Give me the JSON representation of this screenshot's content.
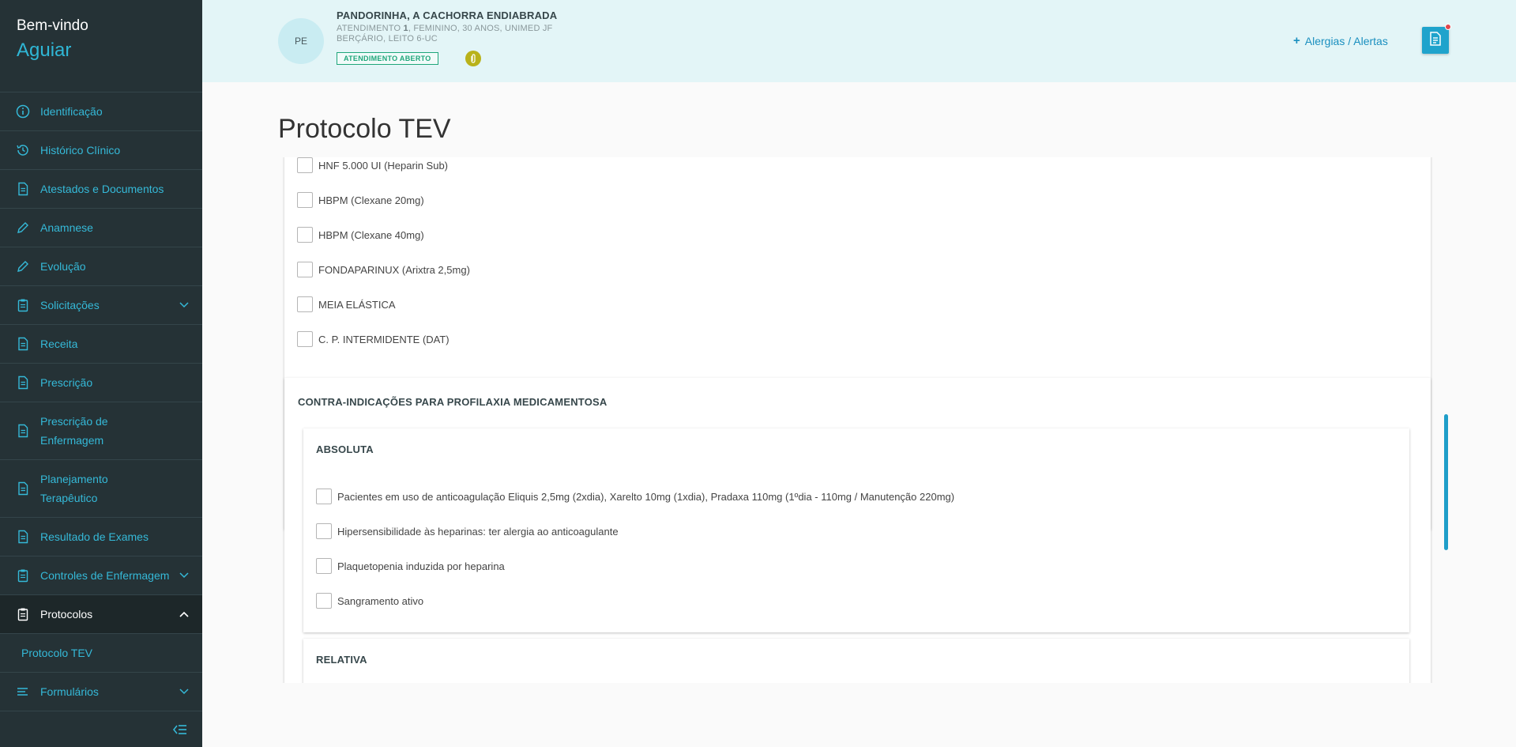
{
  "sidebar": {
    "welcome": "Bem-vindo",
    "user": "Aguiar",
    "items": [
      {
        "label": "Identificação",
        "icon": "info-icon"
      },
      {
        "label": "Histórico Clínico",
        "icon": "history-icon"
      },
      {
        "label": "Atestados e Documentos",
        "icon": "document-icon"
      },
      {
        "label": "Anamnese",
        "icon": "pencil-icon"
      },
      {
        "label": "Evolução",
        "icon": "pencil-icon"
      },
      {
        "label": "Solicitações",
        "icon": "clipboard-icon"
      },
      {
        "label": "Receita",
        "icon": "document-icon"
      },
      {
        "label": "Prescrição",
        "icon": "document-icon"
      },
      {
        "label": "Prescrição de Enfermagem",
        "icon": "document-icon"
      },
      {
        "label": "Planejamento Terapêutico",
        "icon": "document-icon"
      },
      {
        "label": "Resultado de Exames",
        "icon": "document-icon"
      },
      {
        "label": "Controles de Enfermagem",
        "icon": "clipboard-icon"
      },
      {
        "label": "Protocolos",
        "icon": "clipboard-icon"
      },
      {
        "label": "Formulários",
        "icon": "list-icon"
      }
    ],
    "sub_item": "Protocolo TEV"
  },
  "patient": {
    "initials": "PE",
    "name": "PANDORINHA, A CACHORRA ENDIABRADA",
    "line1_prefix": "ATENDIMENTO",
    "line1_number": "1",
    "line1_rest": ", FEMININO, 30 ANOS, UNIMED JF",
    "line2": "BERÇÁRIO, LEITO 6-UC",
    "status": "ATENDIMENTO ABERTO"
  },
  "header": {
    "alerts_label": "Alergias / Alertas"
  },
  "page": {
    "title": "Protocolo TEV"
  },
  "prophylaxis_options": [
    "HNF 5.000 UI (Heparin Sub)",
    "HBPM (Clexane 20mg)",
    "HBPM (Clexane 40mg)",
    "FONDAPARINUX (Arixtra 2,5mg)",
    "MEIA ELÁSTICA",
    "C. P. INTERMIDENTE (DAT)"
  ],
  "contraindications": {
    "title": "CONTRA-INDICAÇÕES PARA PROFILAXIA MEDICAMENTOSA",
    "absolute": {
      "title": "ABSOLUTA",
      "items": [
        "Pacientes em uso de anticoagulação Eliquis 2,5mg (2xdia), Xarelto 10mg (1xdia), Pradaxa 110mg (1ºdia - 110mg / Manutenção 220mg)",
        "Hipersensibilidade às heparinas: ter alergia ao anticoagulante",
        "Plaquetopenia induzida por heparina",
        "Sangramento ativo"
      ]
    },
    "relative": {
      "title": "RELATIVA"
    }
  },
  "colors": {
    "sidebar_bg": "#253236",
    "accent": "#35b9d8",
    "header_bg": "#e3f5f7",
    "status_green": "#1fa67a"
  }
}
